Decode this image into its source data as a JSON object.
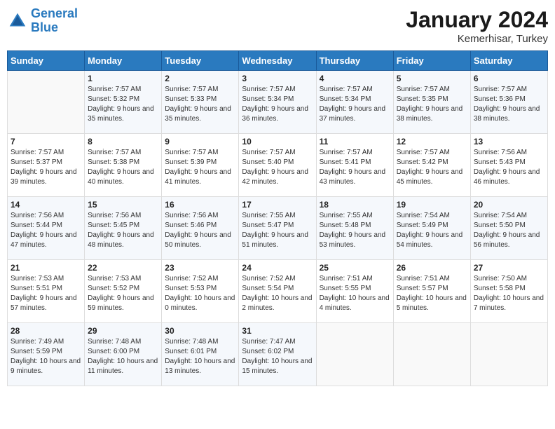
{
  "header": {
    "logo_line1": "General",
    "logo_line2": "Blue",
    "month": "January 2024",
    "location": "Kemerhisar, Turkey"
  },
  "days_of_week": [
    "Sunday",
    "Monday",
    "Tuesday",
    "Wednesday",
    "Thursday",
    "Friday",
    "Saturday"
  ],
  "weeks": [
    [
      {
        "day": "",
        "sunrise": "",
        "sunset": "",
        "daylight": ""
      },
      {
        "day": "1",
        "sunrise": "Sunrise: 7:57 AM",
        "sunset": "Sunset: 5:32 PM",
        "daylight": "Daylight: 9 hours and 35 minutes."
      },
      {
        "day": "2",
        "sunrise": "Sunrise: 7:57 AM",
        "sunset": "Sunset: 5:33 PM",
        "daylight": "Daylight: 9 hours and 35 minutes."
      },
      {
        "day": "3",
        "sunrise": "Sunrise: 7:57 AM",
        "sunset": "Sunset: 5:34 PM",
        "daylight": "Daylight: 9 hours and 36 minutes."
      },
      {
        "day": "4",
        "sunrise": "Sunrise: 7:57 AM",
        "sunset": "Sunset: 5:34 PM",
        "daylight": "Daylight: 9 hours and 37 minutes."
      },
      {
        "day": "5",
        "sunrise": "Sunrise: 7:57 AM",
        "sunset": "Sunset: 5:35 PM",
        "daylight": "Daylight: 9 hours and 38 minutes."
      },
      {
        "day": "6",
        "sunrise": "Sunrise: 7:57 AM",
        "sunset": "Sunset: 5:36 PM",
        "daylight": "Daylight: 9 hours and 38 minutes."
      }
    ],
    [
      {
        "day": "7",
        "sunrise": "Sunrise: 7:57 AM",
        "sunset": "Sunset: 5:37 PM",
        "daylight": "Daylight: 9 hours and 39 minutes."
      },
      {
        "day": "8",
        "sunrise": "Sunrise: 7:57 AM",
        "sunset": "Sunset: 5:38 PM",
        "daylight": "Daylight: 9 hours and 40 minutes."
      },
      {
        "day": "9",
        "sunrise": "Sunrise: 7:57 AM",
        "sunset": "Sunset: 5:39 PM",
        "daylight": "Daylight: 9 hours and 41 minutes."
      },
      {
        "day": "10",
        "sunrise": "Sunrise: 7:57 AM",
        "sunset": "Sunset: 5:40 PM",
        "daylight": "Daylight: 9 hours and 42 minutes."
      },
      {
        "day": "11",
        "sunrise": "Sunrise: 7:57 AM",
        "sunset": "Sunset: 5:41 PM",
        "daylight": "Daylight: 9 hours and 43 minutes."
      },
      {
        "day": "12",
        "sunrise": "Sunrise: 7:57 AM",
        "sunset": "Sunset: 5:42 PM",
        "daylight": "Daylight: 9 hours and 45 minutes."
      },
      {
        "day": "13",
        "sunrise": "Sunrise: 7:56 AM",
        "sunset": "Sunset: 5:43 PM",
        "daylight": "Daylight: 9 hours and 46 minutes."
      }
    ],
    [
      {
        "day": "14",
        "sunrise": "Sunrise: 7:56 AM",
        "sunset": "Sunset: 5:44 PM",
        "daylight": "Daylight: 9 hours and 47 minutes."
      },
      {
        "day": "15",
        "sunrise": "Sunrise: 7:56 AM",
        "sunset": "Sunset: 5:45 PM",
        "daylight": "Daylight: 9 hours and 48 minutes."
      },
      {
        "day": "16",
        "sunrise": "Sunrise: 7:56 AM",
        "sunset": "Sunset: 5:46 PM",
        "daylight": "Daylight: 9 hours and 50 minutes."
      },
      {
        "day": "17",
        "sunrise": "Sunrise: 7:55 AM",
        "sunset": "Sunset: 5:47 PM",
        "daylight": "Daylight: 9 hours and 51 minutes."
      },
      {
        "day": "18",
        "sunrise": "Sunrise: 7:55 AM",
        "sunset": "Sunset: 5:48 PM",
        "daylight": "Daylight: 9 hours and 53 minutes."
      },
      {
        "day": "19",
        "sunrise": "Sunrise: 7:54 AM",
        "sunset": "Sunset: 5:49 PM",
        "daylight": "Daylight: 9 hours and 54 minutes."
      },
      {
        "day": "20",
        "sunrise": "Sunrise: 7:54 AM",
        "sunset": "Sunset: 5:50 PM",
        "daylight": "Daylight: 9 hours and 56 minutes."
      }
    ],
    [
      {
        "day": "21",
        "sunrise": "Sunrise: 7:53 AM",
        "sunset": "Sunset: 5:51 PM",
        "daylight": "Daylight: 9 hours and 57 minutes."
      },
      {
        "day": "22",
        "sunrise": "Sunrise: 7:53 AM",
        "sunset": "Sunset: 5:52 PM",
        "daylight": "Daylight: 9 hours and 59 minutes."
      },
      {
        "day": "23",
        "sunrise": "Sunrise: 7:52 AM",
        "sunset": "Sunset: 5:53 PM",
        "daylight": "Daylight: 10 hours and 0 minutes."
      },
      {
        "day": "24",
        "sunrise": "Sunrise: 7:52 AM",
        "sunset": "Sunset: 5:54 PM",
        "daylight": "Daylight: 10 hours and 2 minutes."
      },
      {
        "day": "25",
        "sunrise": "Sunrise: 7:51 AM",
        "sunset": "Sunset: 5:55 PM",
        "daylight": "Daylight: 10 hours and 4 minutes."
      },
      {
        "day": "26",
        "sunrise": "Sunrise: 7:51 AM",
        "sunset": "Sunset: 5:57 PM",
        "daylight": "Daylight: 10 hours and 5 minutes."
      },
      {
        "day": "27",
        "sunrise": "Sunrise: 7:50 AM",
        "sunset": "Sunset: 5:58 PM",
        "daylight": "Daylight: 10 hours and 7 minutes."
      }
    ],
    [
      {
        "day": "28",
        "sunrise": "Sunrise: 7:49 AM",
        "sunset": "Sunset: 5:59 PM",
        "daylight": "Daylight: 10 hours and 9 minutes."
      },
      {
        "day": "29",
        "sunrise": "Sunrise: 7:48 AM",
        "sunset": "Sunset: 6:00 PM",
        "daylight": "Daylight: 10 hours and 11 minutes."
      },
      {
        "day": "30",
        "sunrise": "Sunrise: 7:48 AM",
        "sunset": "Sunset: 6:01 PM",
        "daylight": "Daylight: 10 hours and 13 minutes."
      },
      {
        "day": "31",
        "sunrise": "Sunrise: 7:47 AM",
        "sunset": "Sunset: 6:02 PM",
        "daylight": "Daylight: 10 hours and 15 minutes."
      },
      {
        "day": "",
        "sunrise": "",
        "sunset": "",
        "daylight": ""
      },
      {
        "day": "",
        "sunrise": "",
        "sunset": "",
        "daylight": ""
      },
      {
        "day": "",
        "sunrise": "",
        "sunset": "",
        "daylight": ""
      }
    ]
  ]
}
